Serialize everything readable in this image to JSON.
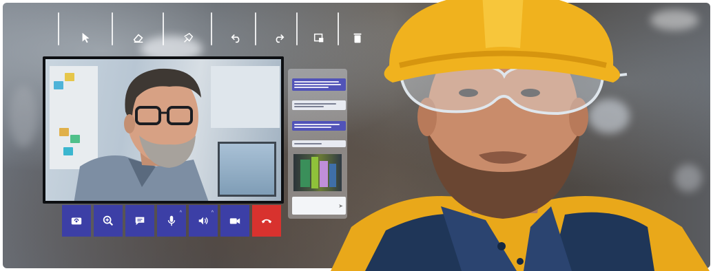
{
  "top_toolbar": {
    "tools": [
      {
        "icon": "pointer-icon"
      },
      {
        "icon": "eraser-icon"
      },
      {
        "icon": "pin-icon"
      },
      {
        "icon": "undo-icon"
      },
      {
        "icon": "redo-icon"
      },
      {
        "icon": "capture-icon"
      },
      {
        "icon": "trash-icon"
      }
    ]
  },
  "call_controls": [
    {
      "icon": "camera-switch-icon"
    },
    {
      "icon": "zoom-icon"
    },
    {
      "icon": "chat-icon"
    },
    {
      "icon": "microphone-icon"
    },
    {
      "icon": "speaker-icon"
    },
    {
      "icon": "video-camera-icon"
    },
    {
      "icon": "end-call-icon",
      "color": "#d8322e"
    }
  ],
  "chat": {
    "messages": [
      {
        "type": "sent"
      },
      {
        "type": "recv"
      },
      {
        "type": "sent"
      },
      {
        "type": "recv"
      }
    ],
    "has_image_attachment": true
  },
  "colors": {
    "accent": "#3c3fa6",
    "end_call": "#d8322e",
    "helmet": "#f0b21e",
    "jacket": "#e9a81a"
  }
}
